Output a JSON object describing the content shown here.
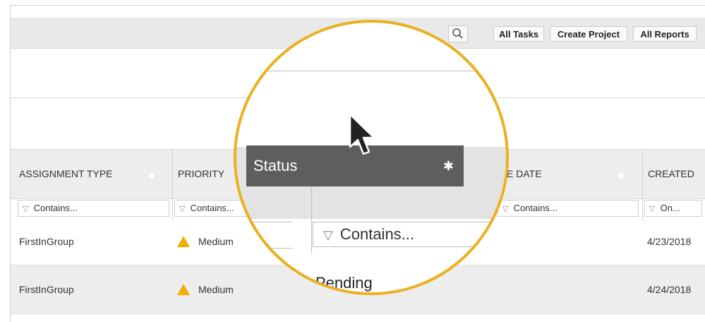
{
  "toolbar": {
    "all_tasks": "All Tasks",
    "create_project": "Create Project",
    "all_reports": "All Reports",
    "search_icon": "search-icon"
  },
  "columns": [
    {
      "title": "ASSIGNMENT TYPE",
      "filter": "Contains..."
    },
    {
      "title": "PRIORITY",
      "filter": "Contains..."
    },
    {
      "title": "E DATE",
      "filter": "Contains..."
    },
    {
      "title": "CREATED",
      "filter": "On..."
    }
  ],
  "magnifier": {
    "status_label": "Status",
    "filter_placeholder": "Contains...",
    "pending": "Pending"
  },
  "rows": [
    {
      "assignment_type": "FirstInGroup",
      "priority": "Medium",
      "created": "4/23/2018"
    },
    {
      "assignment_type": "FirstInGroup",
      "priority": "Medium",
      "created": "4/24/2018"
    }
  ],
  "colors": {
    "accent_ring": "#eab020",
    "warning": "#f0b000",
    "drag_chip": "#5e5e5e"
  }
}
